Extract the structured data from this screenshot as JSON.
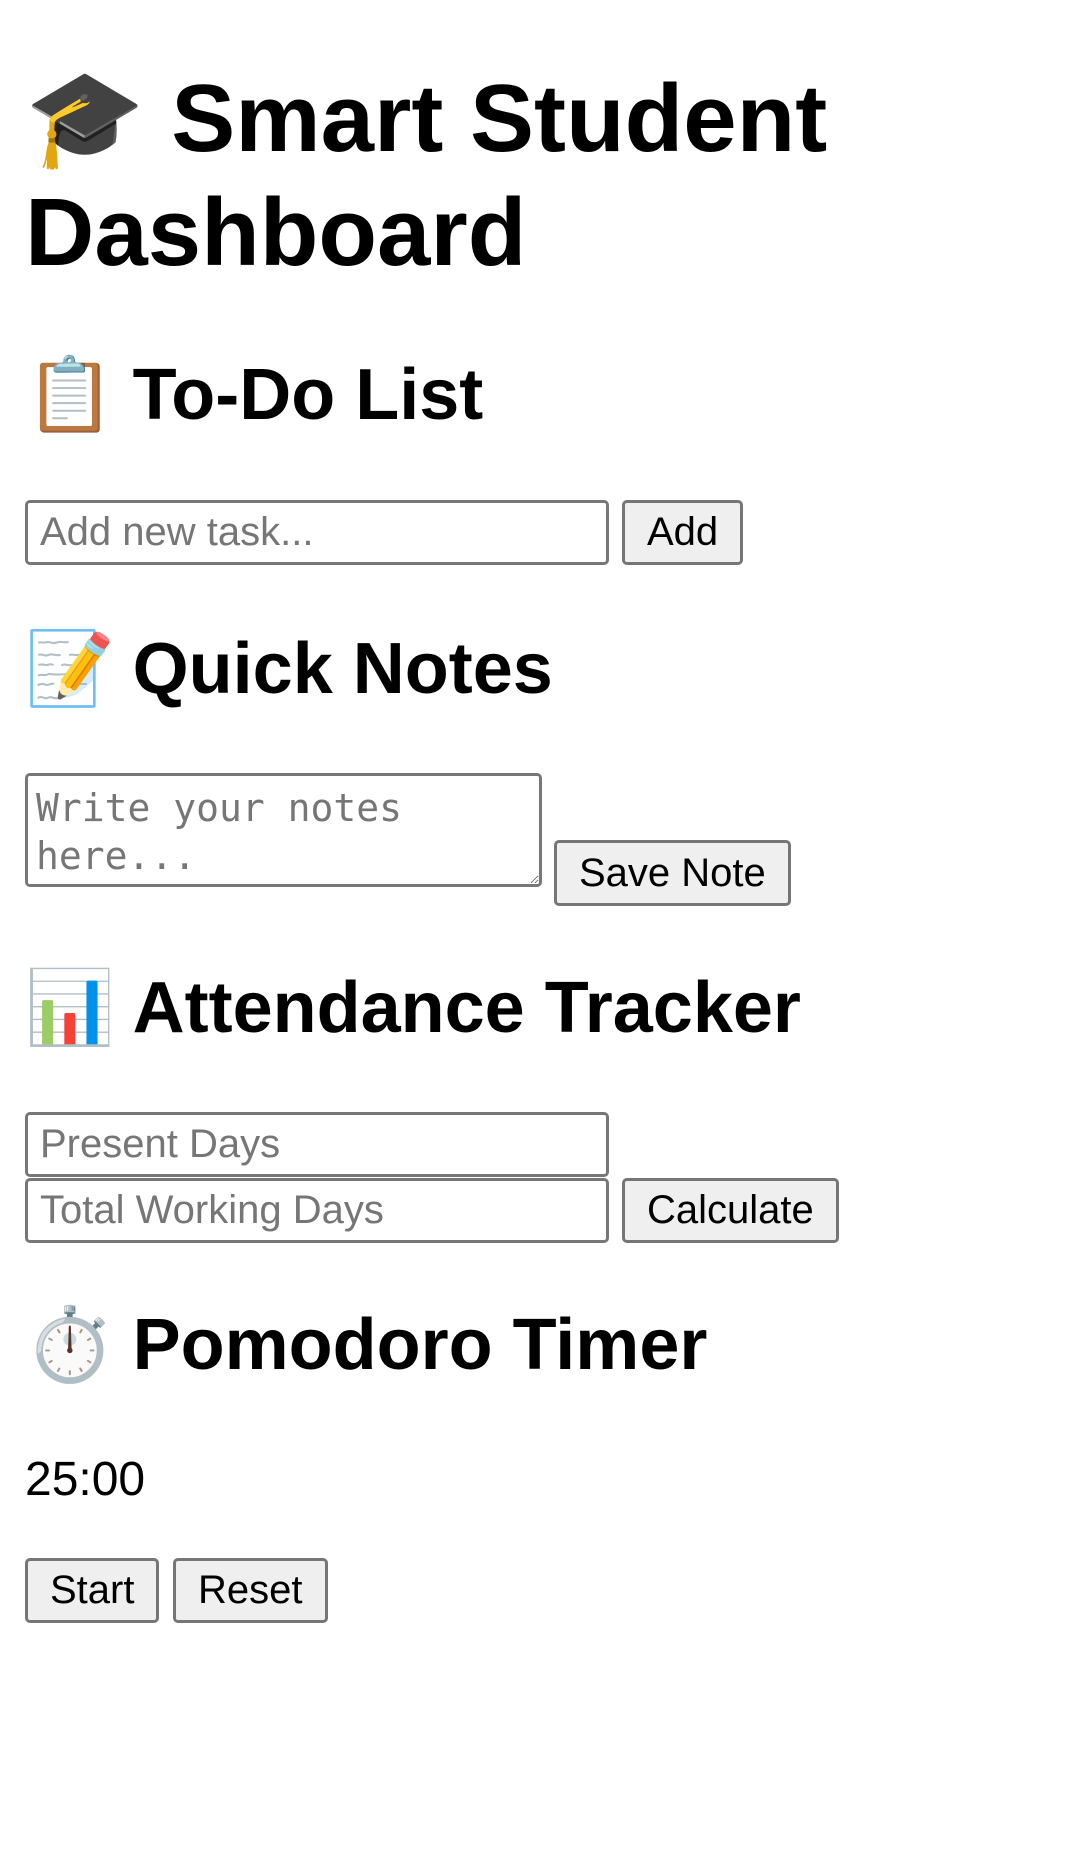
{
  "header": {
    "title": "🎓 Smart Student Dashboard"
  },
  "todo": {
    "heading_icon": "📋",
    "heading": "To-Do List",
    "input_placeholder": "Add new task...",
    "add_label": "Add"
  },
  "notes": {
    "heading_icon": "📝",
    "heading": "Quick Notes",
    "textarea_placeholder": "Write your notes here...",
    "save_label": "Save Note"
  },
  "attendance": {
    "heading_icon": "📊",
    "heading": "Attendance Tracker",
    "present_placeholder": "Present Days",
    "total_placeholder": "Total Working Days",
    "calculate_label": "Calculate"
  },
  "pomodoro": {
    "heading_icon": "⏱️",
    "heading": "Pomodoro Timer",
    "time": "25:00",
    "start_label": "Start",
    "reset_label": "Reset"
  }
}
